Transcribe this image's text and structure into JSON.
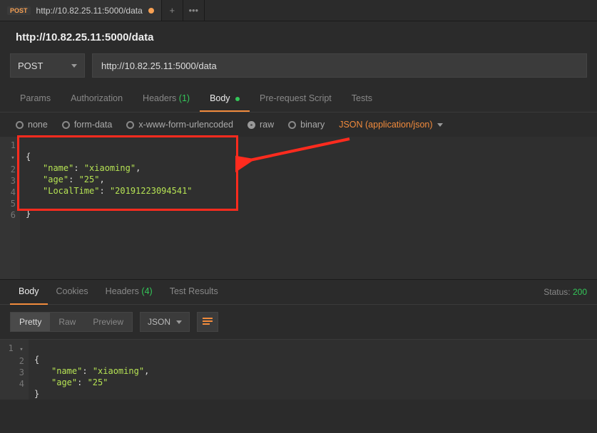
{
  "tab": {
    "method": "POST",
    "title": "http://10.82.25.11:5000/data"
  },
  "title": "http://10.82.25.11:5000/data",
  "urlbar": {
    "method": "POST",
    "url": "http://10.82.25.11:5000/data"
  },
  "reqtabs": {
    "params": "Params",
    "auth": "Authorization",
    "headers": "Headers",
    "headers_count": "(1)",
    "body": "Body",
    "prescript": "Pre-request Script",
    "tests": "Tests"
  },
  "bodytype": {
    "none": "none",
    "formdata": "form-data",
    "xform": "x-www-form-urlencoded",
    "raw": "raw",
    "binary": "binary",
    "contenttype": "JSON (application/json)"
  },
  "reqbody": {
    "l1": "{",
    "k1": "\"name\"",
    "v1": "\"xiaoming\"",
    "k2": "\"age\"",
    "v2": "\"25\"",
    "k3": "\"LocalTime\"",
    "v3": "\"20191223094541\"",
    "l6": "}"
  },
  "resptabs": {
    "body": "Body",
    "cookies": "Cookies",
    "headers": "Headers",
    "headers_count": "(4)",
    "results": "Test Results"
  },
  "status": {
    "label": "Status:",
    "value": "200"
  },
  "resptoolbar": {
    "pretty": "Pretty",
    "raw": "Raw",
    "preview": "Preview",
    "format": "JSON"
  },
  "respbody": {
    "l1": "{",
    "k1": "\"name\"",
    "v1": "\"xiaoming\"",
    "k2": "\"age\"",
    "v2": "\"25\"",
    "l4": "}"
  },
  "gutters": {
    "req": [
      "1",
      "2",
      "3",
      "4",
      "5",
      "6"
    ],
    "resp": [
      "1",
      "2",
      "3",
      "4"
    ]
  }
}
